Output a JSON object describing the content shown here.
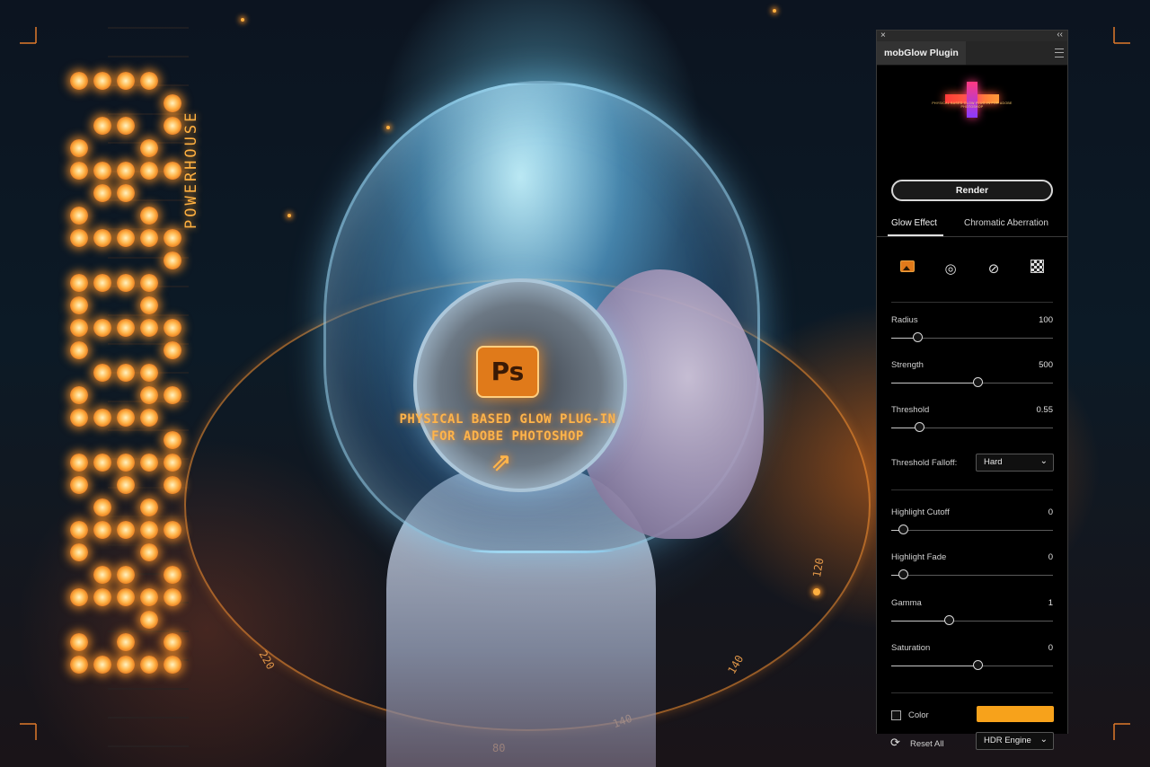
{
  "artwork": {
    "vertical_title": "POWERHOUSE",
    "ps_logo": "Ps",
    "headline_line1": "PHYSICAL BASED GLOW PLUG-IN",
    "headline_line2": "FOR ADOBE PHOTOSHOP",
    "dial_labels": [
      "220",
      "140",
      "120",
      "140",
      "80"
    ],
    "accent_color": "#FF9A2E"
  },
  "panel": {
    "close_glyph": "×",
    "collapse_glyph": "‹‹",
    "title": "mobGlow Plugin",
    "logo_tiny_text": "PHYSICAL BASED GLOW PLUG-IN FOR ADOBE PHOTOSHOP",
    "render_label": "Render",
    "tabs": [
      {
        "label": "Glow Effect",
        "active": true
      },
      {
        "label": "Chromatic Aberration",
        "active": false
      }
    ],
    "mode_icons": [
      "image-icon",
      "eyedropper-circle-icon",
      "brush-circle-icon",
      "checkerboard-icon"
    ],
    "params": [
      {
        "label": "Radius",
        "value": "100",
        "fraction": 0.13
      },
      {
        "label": "Strength",
        "value": "500",
        "fraction": 0.5
      },
      {
        "label": "Threshold",
        "value": "0.55",
        "fraction": 0.14
      }
    ],
    "threshold_falloff": {
      "label": "Threshold Falloff:",
      "selected": "Hard"
    },
    "params2": [
      {
        "label": "Highlight Cutoff",
        "value": "0",
        "fraction": 0.04
      },
      {
        "label": "Highlight Fade",
        "value": "0",
        "fraction": 0.04
      },
      {
        "label": "Gamma",
        "value": "1",
        "fraction": 0.32
      },
      {
        "label": "Saturation",
        "value": "0",
        "fraction": 0.5
      }
    ],
    "color_label": "Color",
    "color_value": "#F7A21B",
    "reset_label": "Reset All",
    "engine_selected": "HDR Engine"
  }
}
